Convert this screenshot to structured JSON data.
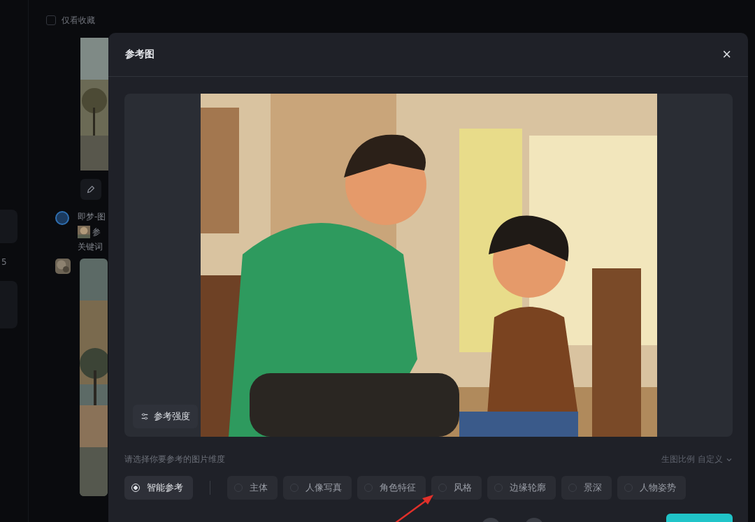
{
  "background": {
    "filter": {
      "label": "仅看收藏",
      "checked": false
    },
    "feed_title": "即梦-图",
    "feed_ref": "参",
    "feed_note": "关键词",
    "counter": "5"
  },
  "dialog": {
    "title": "参考图",
    "close": "×",
    "strength_button": "参考强度",
    "prompt": "请选择你要参考的图片维度",
    "ratio_label": "生图比例 自定义",
    "options": [
      {
        "label": "智能参考",
        "selected": true
      },
      {
        "label": "主体",
        "selected": false
      },
      {
        "label": "人像写真",
        "selected": false
      },
      {
        "label": "角色特征",
        "selected": false
      },
      {
        "label": "风格",
        "selected": false
      },
      {
        "label": "边缘轮廓",
        "selected": false
      },
      {
        "label": "景深",
        "selected": false
      },
      {
        "label": "人物姿势",
        "selected": false
      }
    ]
  }
}
